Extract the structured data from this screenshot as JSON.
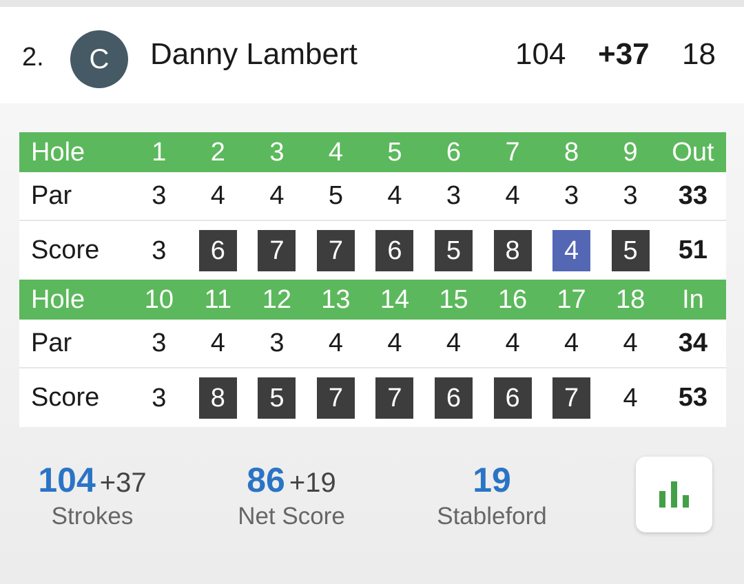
{
  "player": {
    "rank": "2.",
    "avatar_initial": "C",
    "name": "Danny Lambert",
    "strokes": "104",
    "to_par": "+37",
    "thru": "18"
  },
  "scorecard": {
    "front": {
      "hole_label": "Hole",
      "holes": [
        "1",
        "2",
        "3",
        "4",
        "5",
        "6",
        "7",
        "8",
        "9"
      ],
      "total_label": "Out",
      "par_label": "Par",
      "par": [
        "3",
        "4",
        "4",
        "5",
        "4",
        "3",
        "4",
        "3",
        "3"
      ],
      "par_total": "33",
      "score_label": "Score",
      "scores": [
        "3",
        "6",
        "7",
        "7",
        "6",
        "5",
        "8",
        "4",
        "5"
      ],
      "score_total": "51"
    },
    "back": {
      "hole_label": "Hole",
      "holes": [
        "10",
        "11",
        "12",
        "13",
        "14",
        "15",
        "16",
        "17",
        "18"
      ],
      "total_label": "In",
      "par_label": "Par",
      "par": [
        "3",
        "4",
        "3",
        "4",
        "4",
        "4",
        "4",
        "4",
        "4"
      ],
      "par_total": "34",
      "score_label": "Score",
      "scores": [
        "3",
        "8",
        "5",
        "7",
        "7",
        "6",
        "6",
        "7",
        "4"
      ],
      "score_total": "53"
    }
  },
  "summary": {
    "strokes": {
      "value": "104",
      "diff": "+37",
      "label": "Strokes"
    },
    "net": {
      "value": "86",
      "diff": "+19",
      "label": "Net Score"
    },
    "stableford": {
      "value": "19",
      "label": "Stableford"
    }
  },
  "icons": {
    "chart_button": "bar-chart-icon"
  },
  "colors": {
    "header_green": "#5cb85c",
    "bogey": "#5467b4",
    "double_bogey": "#3d3d3d",
    "birdie": "#64b5f6",
    "stat_blue": "#2a74c5",
    "icon_green": "#43a047"
  }
}
